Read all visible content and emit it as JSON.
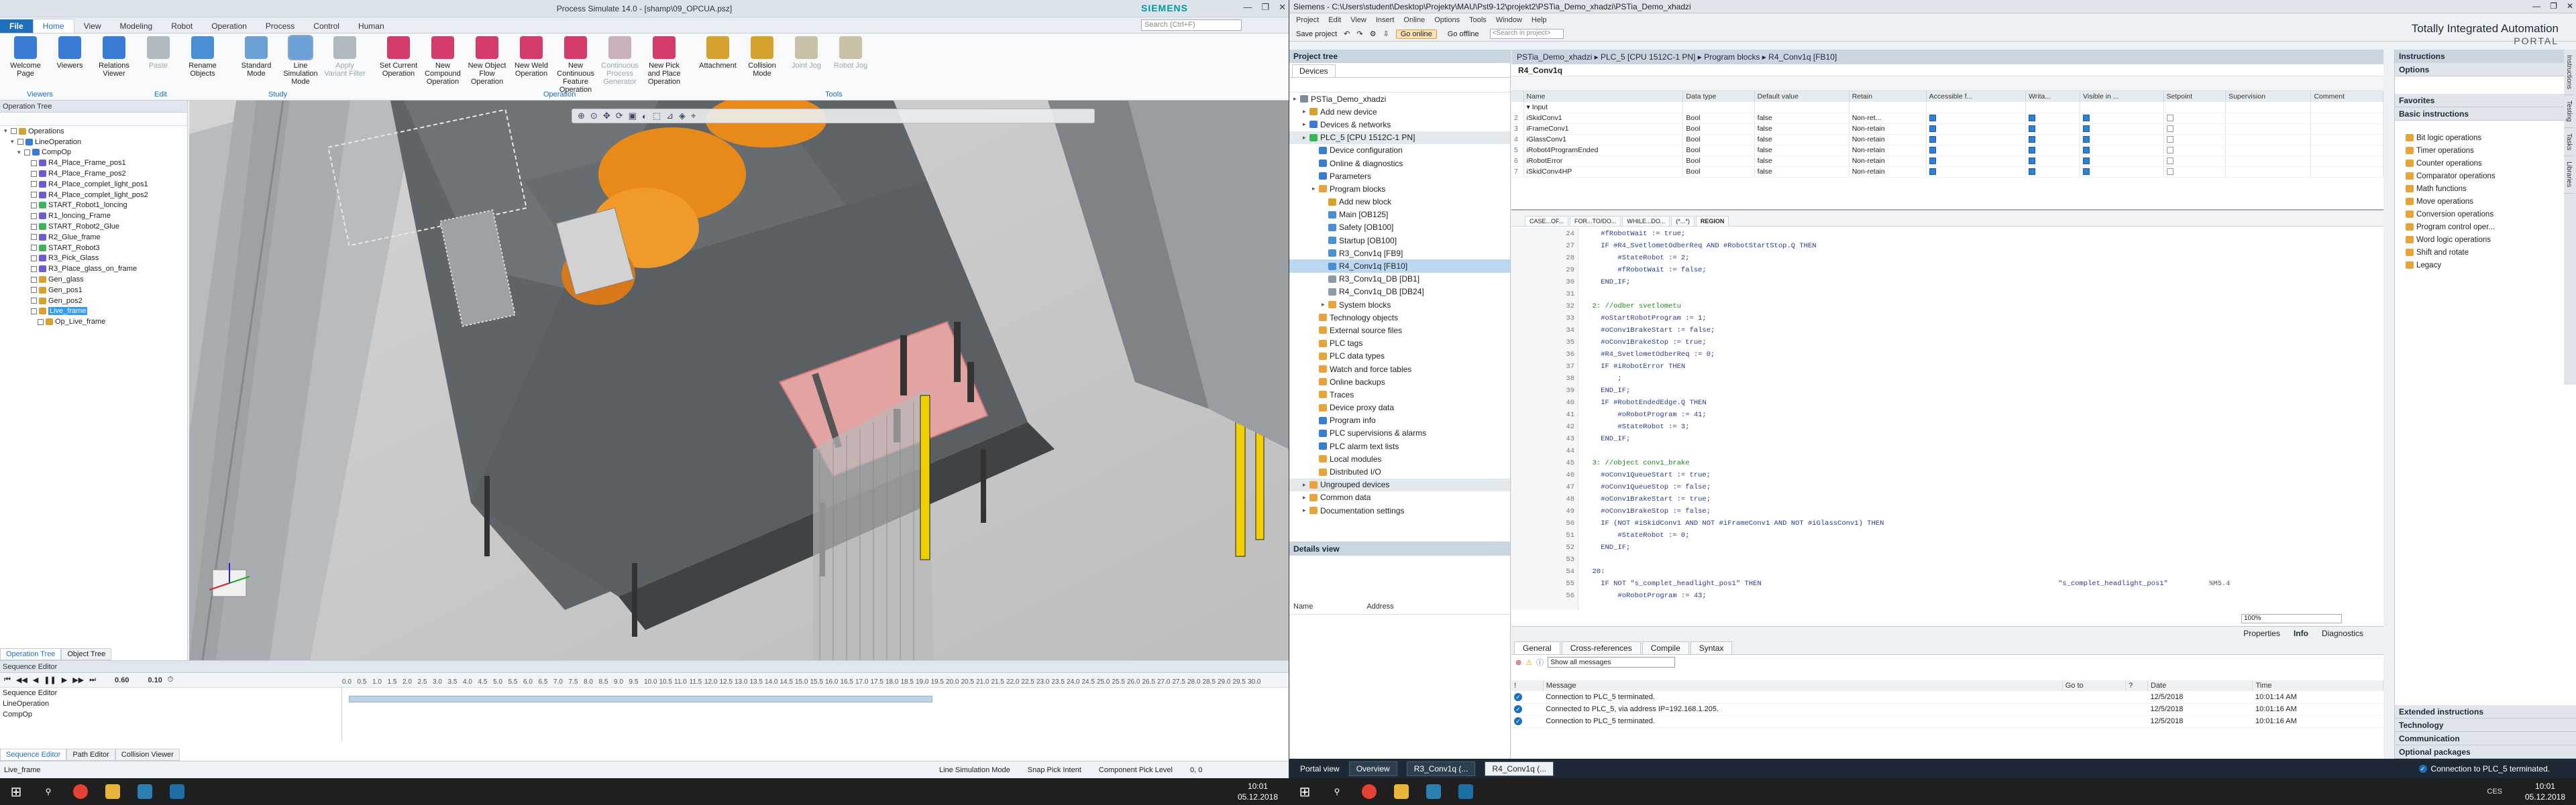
{
  "process_simulate": {
    "title": "Process Simulate 14.0 - [shamp\\09_OPCUA.psz]",
    "brand": "SIEMENS",
    "window_buttons": [
      "—",
      "❐",
      "✕"
    ],
    "search_placeholder": "Search (Ctrl+F)",
    "tabs": [
      "File",
      "Home",
      "View",
      "Modeling",
      "Robot",
      "Operation",
      "Process",
      "Control",
      "Human"
    ],
    "ribbon": [
      {
        "label": "Welcome Page",
        "color": "#3a7bd5",
        "icon": "home-icon"
      },
      {
        "label": "Viewers",
        "color": "#3a7bd5",
        "icon": "viewers-icon"
      },
      {
        "label": "Relations Viewer",
        "color": "#3a7bd5",
        "icon": "relations-icon"
      },
      {
        "label": "Paste",
        "color": "#b0b8c0",
        "icon": "paste-icon",
        "dim": true
      },
      {
        "label": "Rename Objects",
        "color": "#4a8fd6",
        "icon": "rename-icon"
      },
      {
        "label": "Standard Mode",
        "color": "#6a9fd8",
        "icon": "standard-mode-icon"
      },
      {
        "label": "Line Simulation Mode",
        "color": "#6a9fd8",
        "icon": "line-sim-icon",
        "selected": true
      },
      {
        "label": "Apply Variant Filter",
        "color": "#b0b8c0",
        "icon": "filter-icon",
        "dim": true
      },
      {
        "label": "Set Current Operation",
        "color": "#d33c6a",
        "icon": "set-op-icon"
      },
      {
        "label": "New Compound Operation",
        "color": "#d33c6a",
        "icon": "compound-op-icon"
      },
      {
        "label": "New Object Flow Operation",
        "color": "#d33c6a",
        "icon": "object-flow-icon"
      },
      {
        "label": "New Weld Operation",
        "color": "#d33c6a",
        "icon": "weld-op-icon"
      },
      {
        "label": "New Continuous Feature Operation",
        "color": "#d33c6a",
        "icon": "continuous-feature-icon"
      },
      {
        "label": "Continuous Process Generator",
        "color": "#c9b0be",
        "icon": "process-gen-icon",
        "dim": true
      },
      {
        "label": "New Pick and Place Operation",
        "color": "#d33c6a",
        "icon": "pick-place-icon"
      },
      {
        "label": "Attachment",
        "color": "#d7a12f",
        "icon": "attachment-icon"
      },
      {
        "label": "Collision Mode",
        "color": "#d7a12f",
        "icon": "collision-icon"
      },
      {
        "label": "Joint Jog",
        "color": "#c9c0a8",
        "icon": "joint-jog-icon",
        "dim": true
      },
      {
        "label": "Robot Jog",
        "color": "#c9c0a8",
        "icon": "robot-jog-icon",
        "dim": true
      }
    ],
    "ribbon_groups": [
      "Viewers",
      "Edit",
      "Study",
      "Operation",
      "Tools"
    ],
    "optree": {
      "title": "Operation Tree",
      "items": [
        {
          "label": "Operations",
          "depth": 0,
          "color": "#d7a12f"
        },
        {
          "label": "LineOperation",
          "depth": 1,
          "color": "#3a7bd5"
        },
        {
          "label": "CompOp",
          "depth": 2,
          "color": "#3a7bd5"
        },
        {
          "label": "R4_Place_Frame_pos1",
          "depth": 3,
          "color": "#6b5bd5"
        },
        {
          "label": "R4_Place_Frame_pos2",
          "depth": 3,
          "color": "#6b5bd5"
        },
        {
          "label": "R4_Place_complet_light_pos1",
          "depth": 3,
          "color": "#6b5bd5"
        },
        {
          "label": "R4_Place_complet_light_pos2",
          "depth": 3,
          "color": "#6b5bd5"
        },
        {
          "label": "START_Robot1_loncing",
          "depth": 3,
          "color": "#3ab55b"
        },
        {
          "label": "R1_loncing_Frame",
          "depth": 3,
          "color": "#6b5bd5"
        },
        {
          "label": "START_Robot2_Glue",
          "depth": 3,
          "color": "#3ab55b"
        },
        {
          "label": "R2_Glue_frame",
          "depth": 3,
          "color": "#6b5bd5"
        },
        {
          "label": "START_Robot3",
          "depth": 3,
          "color": "#3ab55b"
        },
        {
          "label": "R3_Pick_Glass",
          "depth": 3,
          "color": "#6b5bd5"
        },
        {
          "label": "R3_Place_glass_on_frame",
          "depth": 3,
          "color": "#6b5bd5"
        },
        {
          "label": "Gen_glass",
          "depth": 3,
          "color": "#d7a12f"
        },
        {
          "label": "Gen_pos1",
          "depth": 3,
          "color": "#d7a12f"
        },
        {
          "label": "Gen_pos2",
          "depth": 3,
          "color": "#d7a12f"
        },
        {
          "label": "Live_frame",
          "depth": 3,
          "color": "#d7a12f",
          "selected": true
        },
        {
          "label": "Op_Live_frame",
          "depth": 4,
          "color": "#d7a12f"
        }
      ],
      "tabs": [
        "Operation Tree",
        "Object Tree"
      ]
    },
    "sequence_editor": {
      "title": "Sequence Editor",
      "time_value": "0.60",
      "time_value2": "0.10",
      "rows": [
        "Sequence Editor",
        "LineOperation",
        "CompOp"
      ],
      "ticks": [
        "0.0",
        "0.5",
        "1.0",
        "1.5",
        "2.0",
        "2.5",
        "3.0",
        "3.5",
        "4.0",
        "4.5",
        "5.0",
        "5.5",
        "6.0",
        "6.5",
        "7.0",
        "7.5",
        "8.0",
        "8.5",
        "9.0",
        "9.5",
        "10.0",
        "10.5",
        "11.0",
        "11.5",
        "12.0",
        "12.5",
        "13.0",
        "13.5",
        "14.0",
        "14.5",
        "15.0",
        "15.5",
        "16.0",
        "16.5",
        "17.0",
        "17.5",
        "18.0",
        "18.5",
        "19.0",
        "19.5",
        "20.0",
        "20.5",
        "21.0",
        "21.5",
        "22.0",
        "22.5",
        "23.0",
        "23.5",
        "24.0",
        "24.5",
        "25.0",
        "25.5",
        "26.0",
        "26.5",
        "27.0",
        "27.5",
        "28.0",
        "28.5",
        "29.0",
        "29.5",
        "30.0"
      ],
      "tabs": [
        "Sequence Editor",
        "Path Editor",
        "Collision Viewer"
      ]
    },
    "status": {
      "left": "Live_frame",
      "mode": "Line Simulation Mode",
      "snap": "Snap Pick Intent",
      "pick": "Component Pick Level",
      "coords": "0, 0"
    }
  },
  "tia": {
    "title": "Siemens - C:\\Users\\student\\Desktop\\Projekty\\MAU\\Pst9-12\\projekt2\\PSTia_Demo_xhadzi\\PSTia_Demo_xhadzi",
    "window_buttons": [
      "—",
      "❐",
      "✕"
    ],
    "menu": [
      "Project",
      "Edit",
      "View",
      "Insert",
      "Online",
      "Options",
      "Tools",
      "Window",
      "Help"
    ],
    "toolbar": {
      "save": "Save project",
      "go_online": "Go online",
      "go_offline": "Go offline",
      "search_placeholder": "<Search in project>"
    },
    "brand_line1": "Totally Integrated Automation",
    "brand_line2": "PORTAL",
    "project_tree": {
      "title": "Project tree",
      "tab": "Devices",
      "items": [
        {
          "label": "PSTia_Demo_xhadzi",
          "depth": 0,
          "color": "#7a8a99"
        },
        {
          "label": "Add new device",
          "depth": 1,
          "color": "#d7a12f"
        },
        {
          "label": "Devices & networks",
          "depth": 1,
          "color": "#3a7bd5"
        },
        {
          "label": "PLC_5 [CPU 1512C-1 PN]",
          "depth": 1,
          "color": "#3ab55b",
          "grey": true
        },
        {
          "label": "Device configuration",
          "depth": 2,
          "color": "#3a7bd5"
        },
        {
          "label": "Online & diagnostics",
          "depth": 2,
          "color": "#3a7bd5"
        },
        {
          "label": "Parameters",
          "depth": 2,
          "color": "#3a7bd5"
        },
        {
          "label": "Program blocks",
          "depth": 2,
          "color": "#e8a33a"
        },
        {
          "label": "Add new block",
          "depth": 3,
          "color": "#d7a12f"
        },
        {
          "label": "Main [OB125]",
          "depth": 3,
          "color": "#4a8fd6"
        },
        {
          "label": "Safety [OB100]",
          "depth": 3,
          "color": "#4a8fd6"
        },
        {
          "label": "Startup [OB100]",
          "depth": 3,
          "color": "#4a8fd6"
        },
        {
          "label": "R3_Conv1q [FB9]",
          "depth": 3,
          "color": "#4a8fd6"
        },
        {
          "label": "R4_Conv1q [FB10]",
          "depth": 3,
          "color": "#4a8fd6",
          "selected": true
        },
        {
          "label": "R3_Conv1q_DB [DB1]",
          "depth": 3,
          "color": "#8a9aa8"
        },
        {
          "label": "R4_Conv1q_DB [DB24]",
          "depth": 3,
          "color": "#8a9aa8"
        },
        {
          "label": "System blocks",
          "depth": 3,
          "color": "#e8a33a"
        },
        {
          "label": "Technology objects",
          "depth": 2,
          "color": "#e8a33a"
        },
        {
          "label": "External source files",
          "depth": 2,
          "color": "#e8a33a"
        },
        {
          "label": "PLC tags",
          "depth": 2,
          "color": "#e8a33a"
        },
        {
          "label": "PLC data types",
          "depth": 2,
          "color": "#e8a33a"
        },
        {
          "label": "Watch and force tables",
          "depth": 2,
          "color": "#e8a33a"
        },
        {
          "label": "Online backups",
          "depth": 2,
          "color": "#e8a33a"
        },
        {
          "label": "Traces",
          "depth": 2,
          "color": "#e8a33a"
        },
        {
          "label": "Device proxy data",
          "depth": 2,
          "color": "#e8a33a"
        },
        {
          "label": "Program info",
          "depth": 2,
          "color": "#3a7bd5"
        },
        {
          "label": "PLC supervisions & alarms",
          "depth": 2,
          "color": "#3a7bd5"
        },
        {
          "label": "PLC alarm text lists",
          "depth": 2,
          "color": "#3a7bd5"
        },
        {
          "label": "Local modules",
          "depth": 2,
          "color": "#e8a33a"
        },
        {
          "label": "Distributed I/O",
          "depth": 2,
          "color": "#e8a33a"
        },
        {
          "label": "Ungrouped devices",
          "depth": 1,
          "color": "#e8a33a",
          "grey": true
        },
        {
          "label": "Common data",
          "depth": 1,
          "color": "#e8a33a"
        },
        {
          "label": "Documentation settings",
          "depth": 1,
          "color": "#e8a33a"
        }
      ]
    },
    "details_view": {
      "title": "Details view",
      "col_name": "Name",
      "col_address": "Address"
    },
    "editor": {
      "breadcrumb": [
        "PSTia_Demo_xhadzi",
        "PLC_5 [CPU 1512C-1 PN]",
        "Program blocks",
        "R4_Conv1q [FB10]"
      ],
      "block_name": "R4_Conv1q",
      "interface": {
        "headers": [
          "",
          "Name",
          "Data type",
          "Default value",
          "Retain",
          "Accessible f...",
          "Writa...",
          "Visible in ...",
          "Setpoint",
          "Supervision",
          "Comment"
        ],
        "rows": [
          {
            "n": "",
            "name": "▾ Input",
            "type": "",
            "def": "",
            "ret": "",
            "acc": null,
            "wr": null,
            "vis": null,
            "set": null
          },
          {
            "n": "2",
            "name": "iSkidConv1",
            "type": "Bool",
            "def": "false",
            "ret": "Non-ret...",
            "acc": true,
            "wr": true,
            "vis": true,
            "set": false
          },
          {
            "n": "3",
            "name": "iFrameConv1",
            "type": "Bool",
            "def": "false",
            "ret": "Non-retain",
            "acc": true,
            "wr": true,
            "vis": true,
            "set": false
          },
          {
            "n": "4",
            "name": "iGlassConv1",
            "type": "Bool",
            "def": "false",
            "ret": "Non-retain",
            "acc": true,
            "wr": true,
            "vis": true,
            "set": false
          },
          {
            "n": "5",
            "name": "iRobot4ProgramEnded",
            "type": "Bool",
            "def": "false",
            "ret": "Non-retain",
            "acc": true,
            "wr": true,
            "vis": true,
            "set": false
          },
          {
            "n": "6",
            "name": "iRobotError",
            "type": "Bool",
            "def": "false",
            "ret": "Non-retain",
            "acc": true,
            "wr": true,
            "vis": true,
            "set": false
          },
          {
            "n": "7",
            "name": "iSkidConv4HP",
            "type": "Bool",
            "def": "false",
            "ret": "Non-retain",
            "acc": true,
            "wr": true,
            "vis": true,
            "set": false
          }
        ]
      },
      "net_tabs": [
        "CASE...OF...",
        "FOR...TO/DO...",
        "WHILE...DO...",
        "(*...*)",
        "REGION"
      ],
      "code": [
        {
          "ln": "24",
          "t": "    #fRobotWait := true;"
        },
        {
          "ln": "27",
          "t": "    IF #R4_SvetlometOdberReq AND #RobotStartStop.Q THEN"
        },
        {
          "ln": "28",
          "t": "        #StateRobot := 2;"
        },
        {
          "ln": "29",
          "t": "        #fRobotWait := false;"
        },
        {
          "ln": "30",
          "t": "    END_IF;"
        },
        {
          "ln": "31",
          "t": ""
        },
        {
          "ln": "32",
          "t": "  2: //odber svetlometu",
          "c": true
        },
        {
          "ln": "33",
          "t": "    #oStartRobotProgram := 1;"
        },
        {
          "ln": "34",
          "t": "    #oConv1BrakeStart := false;"
        },
        {
          "ln": "35",
          "t": "    #oConv1BrakeStop := true;"
        },
        {
          "ln": "36",
          "t": "    #R4_SvetlometOdberReq := 0;"
        },
        {
          "ln": "37",
          "t": "    IF #iRobotError THEN"
        },
        {
          "ln": "38",
          "t": "        ;"
        },
        {
          "ln": "39",
          "t": "    END_IF;"
        },
        {
          "ln": "40",
          "t": "    IF #RobotEndedEdge.Q THEN"
        },
        {
          "ln": "41",
          "t": "        #oRobotProgram := 41;"
        },
        {
          "ln": "42",
          "t": "        #StateRobot := 3;"
        },
        {
          "ln": "43",
          "t": "    END_IF;"
        },
        {
          "ln": "44",
          "t": ""
        },
        {
          "ln": "45",
          "t": "  3: //object conv1_brake",
          "c": true
        },
        {
          "ln": "46",
          "t": "    #oConv1QueueStart := true;"
        },
        {
          "ln": "47",
          "t": "    #oConv1QueueStop := false;"
        },
        {
          "ln": "48",
          "t": "    #oConv1BrakeStart := true;"
        },
        {
          "ln": "49",
          "t": "    #oConv1BrakeStop := false;"
        },
        {
          "ln": "50",
          "t": "    IF (NOT #iSkidConv1 AND NOT #iFrameConv1 AND NOT #iGlassConv1) THEN"
        },
        {
          "ln": "51",
          "t": "        #StateRobot := 0;"
        },
        {
          "ln": "52",
          "t": "    END_IF;"
        },
        {
          "ln": "53",
          "t": ""
        },
        {
          "ln": "54",
          "t": "  20:"
        },
        {
          "ln": "55",
          "t": "    IF NOT \"s_complet_headlight_pos1\" THEN",
          "sym": "\"s_complet_headlight_pos1\"",
          "addr": "%M5.4"
        },
        {
          "ln": "56",
          "t": "        #oRobotProgram := 43;"
        }
      ],
      "zoom": "100%"
    },
    "inspector": {
      "properties": "Properties",
      "info": "Info",
      "diagnostics": "Diagnostics",
      "tabs": [
        "General",
        "Cross-references",
        "Compile",
        "Syntax"
      ],
      "filter": "Show all messages",
      "headers": [
        "!",
        "Message",
        "Go to",
        "?",
        "Date",
        "Time"
      ],
      "messages": [
        {
          "msg": "Connection to PLC_5 terminated.",
          "date": "12/5/2018",
          "time": "10:01:14 AM"
        },
        {
          "msg": "Connected to PLC_5, via address IP=192.168.1.205.",
          "date": "12/5/2018",
          "time": "10:01:16 AM"
        },
        {
          "msg": "Connection to PLC_5 terminated.",
          "date": "12/5/2018",
          "time": "10:01:16 AM"
        }
      ]
    },
    "instructions": {
      "title": "Instructions",
      "options": "Options",
      "favorites": "Favorites",
      "basic": "Basic instructions",
      "items": [
        "Bit logic operations",
        "Timer operations",
        "Counter operations",
        "Comparator operations",
        "Math functions",
        "Move operations",
        "Conversion operations",
        "Program control oper...",
        "Word logic operations",
        "Shift and rotate",
        "Legacy"
      ],
      "bottom_sections": [
        "Extended instructions",
        "Technology",
        "Communication",
        "Optional packages"
      ]
    },
    "vertical_tabs": [
      "Instructions",
      "Testing",
      "Tasks",
      "Libraries"
    ],
    "bottom": {
      "portal_view": "Portal view",
      "tabs": [
        "Overview",
        "R3_Conv1q (...",
        "R4_Conv1q (..."
      ],
      "status": "Connection to PLC_5 terminated."
    }
  },
  "taskbar_left": {
    "time": "10:01",
    "date": "05.12.2018"
  },
  "taskbar_right": {
    "time": "10:01",
    "date": "05.12.2018",
    "sys": "CES"
  }
}
